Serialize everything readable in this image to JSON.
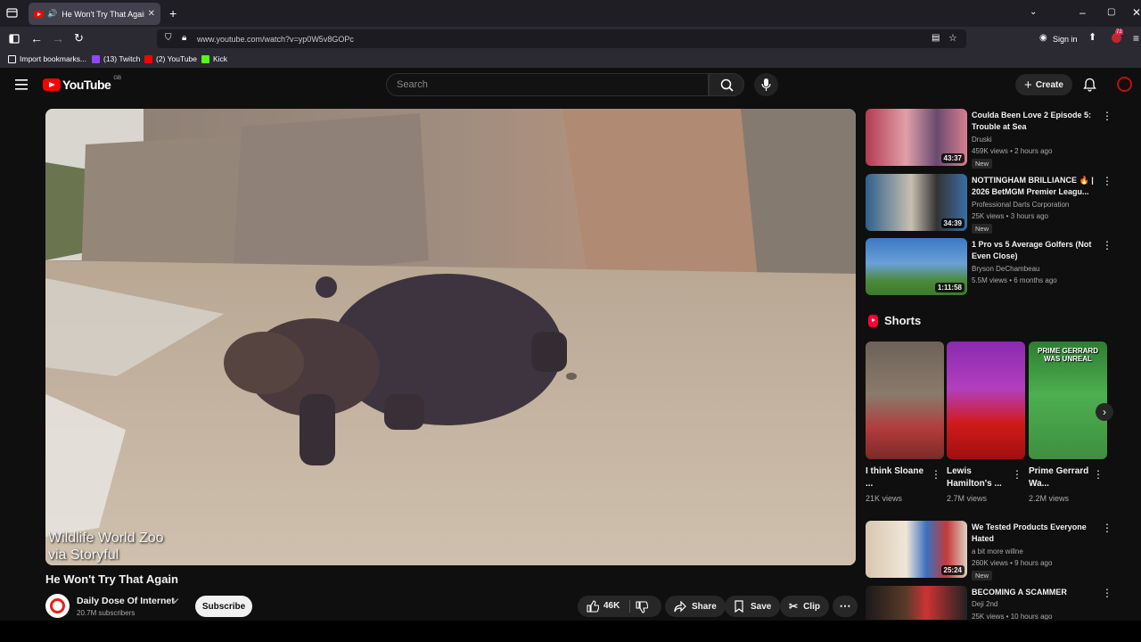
{
  "browser": {
    "tab_title": "He Won't Try That Again - Y",
    "url": "www.youtube.com/watch?v=yp0W5v8GOPc",
    "sign_in": "Sign in",
    "extension_badge": "72",
    "bookmarks": [
      {
        "label": "Import bookmarks...",
        "color": "#fbfbfe"
      },
      {
        "label": "(13) Twitch",
        "color": "#9146ff"
      },
      {
        "label": "(2) YouTube",
        "color": "#ff0000"
      },
      {
        "label": "Kick",
        "color": "#53fc18"
      }
    ]
  },
  "youtube": {
    "logo_text": "YouTube",
    "region": "GB",
    "search_placeholder": "Search",
    "create_label": "Create"
  },
  "video": {
    "caption_line1": "Wildlife World Zoo",
    "caption_line2": "via Storyful",
    "title": "He Won't Try That Again",
    "channel": "Daily Dose Of Internet",
    "subscribers": "20.7M subscribers",
    "subscribe_label": "Subscribe",
    "likes": "46K",
    "share_label": "Share",
    "save_label": "Save",
    "clip_label": "Clip"
  },
  "recommendations": [
    {
      "title": "Coulda Been Love 2 Episode 5: Trouble at Sea",
      "channel": "Druski",
      "meta": "459K views • 2 hours ago",
      "badge": "New",
      "duration": "43:37"
    },
    {
      "title": "NOTTINGHAM BRILLIANCE 🔥 | 2026 BetMGM Premier Leagu...",
      "channel": "Professional Darts Corporation",
      "meta": "25K views • 3 hours ago",
      "badge": "New",
      "duration": "34:39"
    },
    {
      "title": "1 Pro vs 5 Average Golfers (Not Even Close)",
      "channel": "Bryson DeChambeau",
      "meta": "5.5M views • 6 months ago",
      "badge": "",
      "duration": "1:11:58"
    },
    {
      "title": "We Tested Products Everyone Hated",
      "channel": "a bit more willne",
      "meta": "260K views • 9 hours ago",
      "badge": "New",
      "duration": "25:24"
    },
    {
      "title": "BECOMING A SCAMMER",
      "channel": "Deji 2nd",
      "meta": "25K views • 10 hours ago",
      "badge": "",
      "duration": ""
    }
  ],
  "shorts": {
    "heading": "Shorts",
    "items": [
      {
        "title": "I think Sloane ...",
        "views": "21K views"
      },
      {
        "title": "Lewis Hamilton's ...",
        "views": "2.7M views"
      },
      {
        "title": "Prime Gerrard Wa...",
        "views": "2.2M views",
        "overlay": "PRIME GERRARD WAS UNREAL"
      }
    ]
  }
}
